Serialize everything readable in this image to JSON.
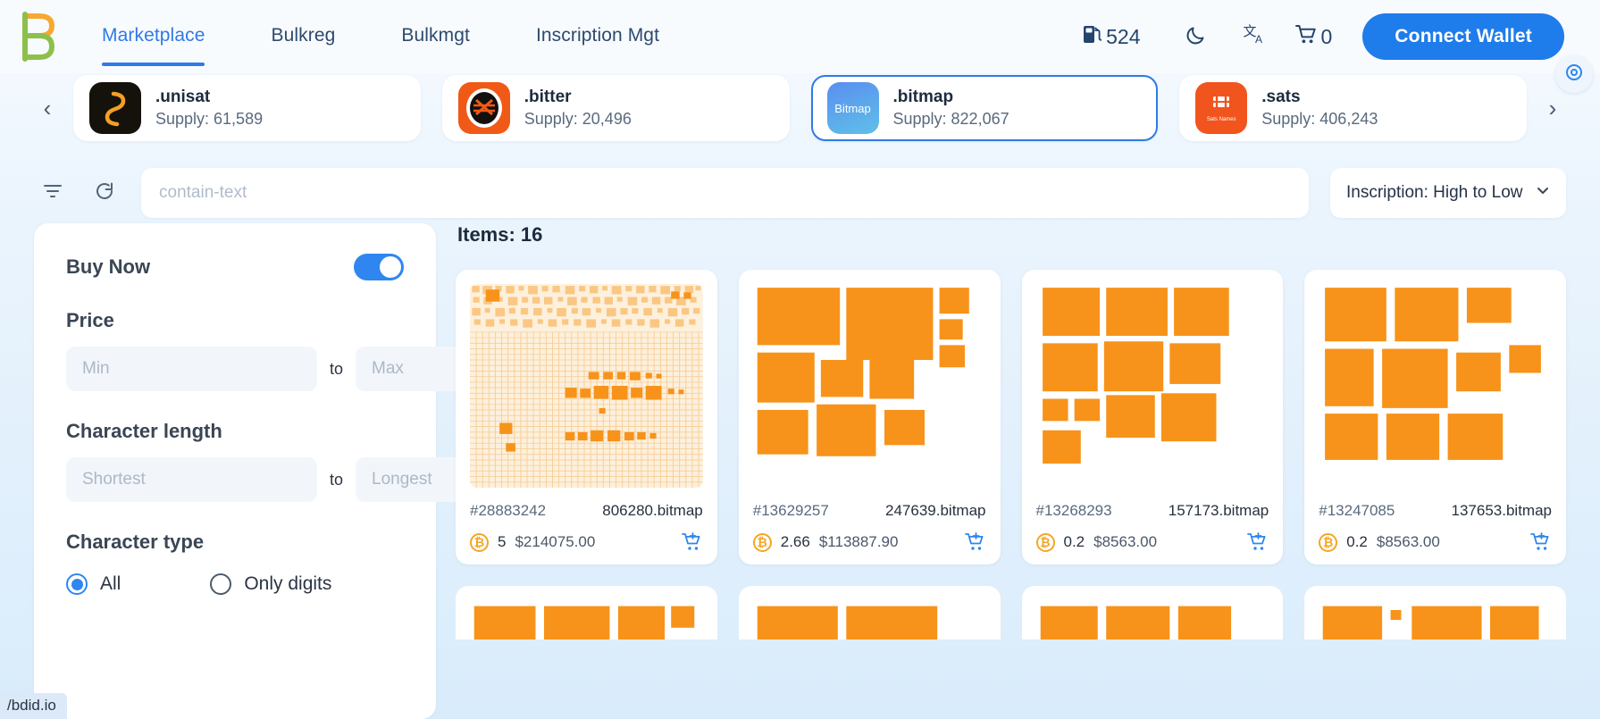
{
  "brand": {
    "logo_name": "bdid-logo",
    "accent": "#1f7ceb",
    "orange": "#f7931a"
  },
  "nav": {
    "tabs": [
      {
        "label": "Marketplace",
        "active": true
      },
      {
        "label": "Bulkreg",
        "active": false
      },
      {
        "label": "Bulkmgt",
        "active": false
      },
      {
        "label": "Inscription Mgt",
        "active": false
      }
    ],
    "gas_value": "524",
    "gas_icon": "gas-pump-icon",
    "theme_icon": "moon-icon",
    "lang_icon": "translate-icon",
    "cart_icon": "cart-icon",
    "cart_count": "0",
    "connect_label": "Connect Wallet"
  },
  "collections": {
    "prev_label": "‹",
    "next_label": "›",
    "items": [
      {
        "name": ".unisat",
        "supply": "Supply: 61,589",
        "logo_text": "S",
        "selected": false
      },
      {
        "name": ".bitter",
        "supply": "Supply: 20,496",
        "logo_text": "#",
        "selected": false
      },
      {
        "name": ".bitmap",
        "supply": "Supply: 822,067",
        "logo_text": "Bitmap",
        "selected": true
      },
      {
        "name": ".sats",
        "supply": "Supply: 406,243",
        "logo_text": "Sats Names",
        "selected": false
      }
    ]
  },
  "search": {
    "filter_icon": "filter-icon",
    "refresh_icon": "refresh-icon",
    "placeholder": "contain-text",
    "value": "",
    "sort_label": "Inscription: High to Low",
    "sort_caret": "chevron-down-icon"
  },
  "filters": {
    "buy_now_label": "Buy Now",
    "buy_now_on": true,
    "price_label": "Price",
    "price_min_placeholder": "Min",
    "price_max_placeholder": "Max",
    "price_min_value": "",
    "price_max_value": "",
    "to_label": "to",
    "charlen_label": "Character length",
    "charlen_min_placeholder": "Shortest",
    "charlen_max_placeholder": "Longest",
    "charlen_min_value": "",
    "charlen_max_value": "",
    "chartype_label": "Character type",
    "chartype_options": [
      {
        "label": "All",
        "selected": true
      },
      {
        "label": "Only digits",
        "selected": false
      }
    ]
  },
  "results": {
    "count_label": "Items: 16",
    "items": [
      {
        "inscription": "#28883242",
        "name": "806280.bitmap",
        "btc": "5",
        "usd": "$214075.00",
        "thumb": "dense-grid"
      },
      {
        "inscription": "#13629257",
        "name": "247639.bitmap",
        "btc": "2.66",
        "usd": "$113887.90",
        "thumb": "blocks-a"
      },
      {
        "inscription": "#13268293",
        "name": "157173.bitmap",
        "btc": "0.2",
        "usd": "$8563.00",
        "thumb": "blocks-b"
      },
      {
        "inscription": "#13247085",
        "name": "137653.bitmap",
        "btc": "0.2",
        "usd": "$8563.00",
        "thumb": "blocks-c"
      }
    ],
    "btc_symbol": "₿",
    "cart_add_icon": "add-to-cart-icon"
  },
  "misc": {
    "side_fab_icon": "support-icon",
    "status_link": "/bdid.io"
  }
}
